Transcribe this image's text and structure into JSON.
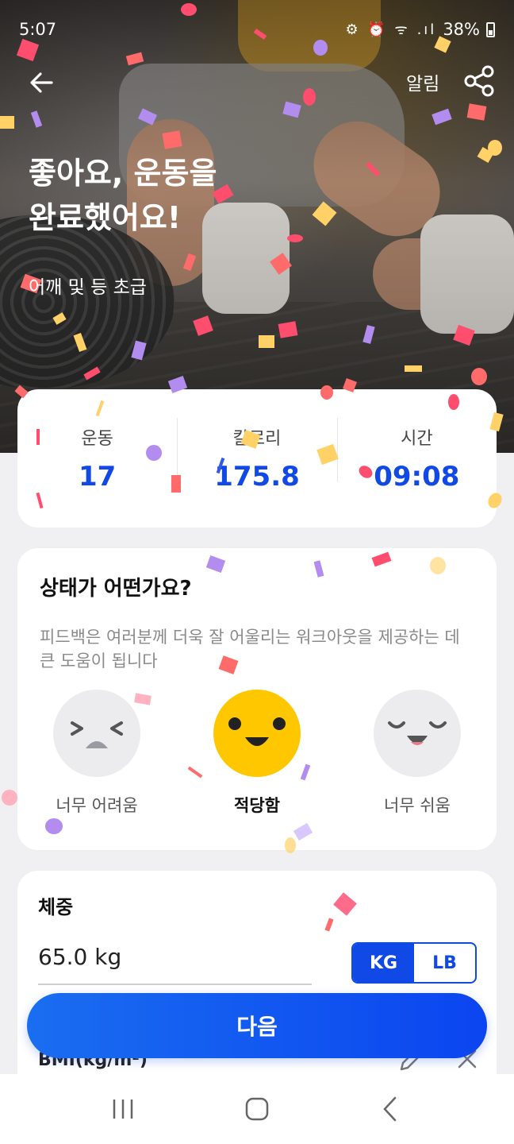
{
  "status_bar": {
    "time": "5:07",
    "icons": "⚙ ⏰ ᯤ .ıl",
    "battery": "38%"
  },
  "app_bar": {
    "back_icon": "arrow-left-icon",
    "alarm_label": "알림",
    "share_icon": "share-icon"
  },
  "hero": {
    "title": "좋아요, 운동을\n완료했어요!",
    "subtitle": "어깨 및 등 초급"
  },
  "stats": [
    {
      "label": "운동",
      "value": "17"
    },
    {
      "label": "칼로리",
      "value": "175.8"
    },
    {
      "label": "시간",
      "value": "09:08"
    }
  ],
  "feeling": {
    "title": "상태가 어떤가요?",
    "description": "피드백은 여러분께 더욱 잘 어울리는 워크아웃을 제공하는 데 큰 도움이 됩니다",
    "options": [
      {
        "label": "너무 어려움",
        "icon": "face-hard-icon",
        "selected": false
      },
      {
        "label": "적당함",
        "icon": "face-moderate-icon",
        "selected": true
      },
      {
        "label": "너무 쉬움",
        "icon": "face-easy-icon",
        "selected": false
      }
    ]
  },
  "weight": {
    "title": "체중",
    "value": "65.0 kg",
    "units": [
      "KG",
      "LB"
    ],
    "selected_unit": "KG",
    "bmi_label": "BMI(kg/m²)"
  },
  "next_button": "다음",
  "colors": {
    "accent": "#1049e6",
    "selected_face": "#ffc700"
  }
}
